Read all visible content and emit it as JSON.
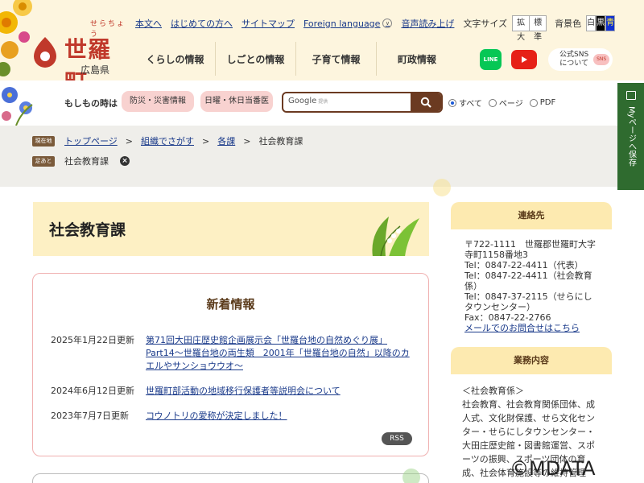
{
  "header": {
    "logo": {
      "kana": "せらちょう",
      "title": "世羅町",
      "prefecture": "広島県"
    },
    "utility_links": [
      "本文へ",
      "はじめての方へ",
      "サイトマップ"
    ],
    "language_link": "Foreign language",
    "read_aloud": "音声読み上げ",
    "font_size_label": "文字サイズ",
    "font_size_buttons": [
      "拡大",
      "標準"
    ],
    "bg_color_label": "背景色",
    "bg_color_buttons": [
      "白",
      "黒",
      "青"
    ],
    "global_nav": [
      "くらしの情報",
      "しごとの情報",
      "子育て情報",
      "町政情報"
    ],
    "social": {
      "line": "LINE",
      "sns_button": "公式SNS\nについて",
      "sns_badge": "SNS"
    }
  },
  "emergency": {
    "label": "もしもの時は",
    "buttons": [
      "防災・災害情報",
      "日曜・休日当番医"
    ],
    "search": {
      "brand": "Google",
      "hint": "提供"
    },
    "scope_options": [
      "すべて",
      "ページ",
      "PDF"
    ],
    "scope_selected": "すべて"
  },
  "mypage": {
    "label": "Myページへ保存"
  },
  "breadcrumb": {
    "current_tag": "現在地",
    "items": [
      "トップページ",
      "組織でさがす",
      "各課",
      "社会教育課"
    ],
    "footprint_tag": "足あと",
    "footprint_item": "社会教育課"
  },
  "main": {
    "title": "社会教育課",
    "news_heading": "新着情報",
    "news": [
      {
        "date": "2025年1月22日更新",
        "text": "第71回大田庄歴史館企画展示会「世羅台地の自然めぐり展」Part14～世羅台地の両生類　2001年「世羅台地の自然」以降のカエルやサンショウウオ～"
      },
      {
        "date": "2024年6月12日更新",
        "text": "世羅町部活動の地域移行保護者等説明会について"
      },
      {
        "date": "2023年7月7日更新",
        "text": "コウノトリの愛称が決定しました！"
      }
    ],
    "rss": "RSS"
  },
  "sidebar": {
    "contact_heading": "連絡先",
    "contact_lines": [
      "〒722-1111　世羅郡世羅町大字寺町1158番地3",
      "Tel：0847-22-4411（代表）",
      "Tel：0847-22-4411（社会教育係）",
      "Tel：0847-37-2115（せらにしタウンセンター）",
      "Fax：0847-22-2766"
    ],
    "contact_link": "メールでのお問合せはこちら",
    "duties_heading": "業務内容",
    "duties_text": "＜社会教育係＞\n社会教育、社会教育関係団体、成人式、文化財保護、せら文化センター・せらにしタウンセンター・大田庄歴史館・図書館運営、スポーツの振興、スポーツ団体の育成、社会体育施設等の維持管理"
  },
  "watermark": "©MDATA",
  "colors": {
    "header_bg": "#fdf5de",
    "accent_red": "#c0392b",
    "search_brown": "#6b3a21",
    "link": "#1a3a8a",
    "mypage_green": "#2f6b2f"
  }
}
